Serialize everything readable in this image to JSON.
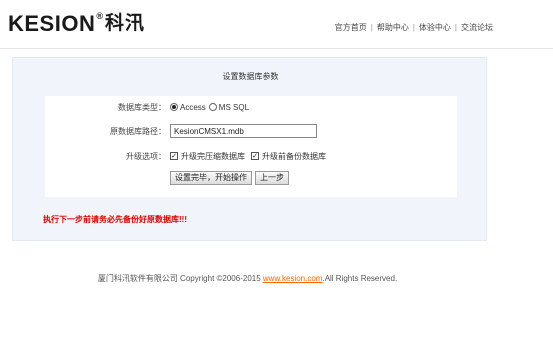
{
  "header": {
    "logo_text": "KESION",
    "logo_reg": "®",
    "logo_cn": "科汛",
    "nav": [
      "官方首页",
      "帮助中心",
      "体验中心",
      "交流论坛"
    ],
    "separator": "|"
  },
  "panel": {
    "title": "设置数据库参数"
  },
  "form": {
    "db_type_label": "数据库类型：",
    "db_type_options": [
      "Access",
      "MS SQL"
    ],
    "db_type_selected": "Access",
    "db_path_label": "原数据库路径：",
    "db_path_value": "KesionCMSX1.mdb",
    "upgrade_label": "升级选项：",
    "upgrade_options": [
      "升级完压缩数据库",
      "升级前备份数据库"
    ],
    "upgrade_checked": [
      true,
      true
    ],
    "check_mark": "✓",
    "submit_button": "设置完毕，开始操作",
    "back_button": "上一步"
  },
  "warning": "执行下一步前请务必先备份好原数据库!!!",
  "footer": {
    "prefix": "厦门科汛软件有限公司 Copyright ©2006-2015 ",
    "link_text": "www.kesion.com",
    "suffix": ".All Rights Reserved."
  }
}
